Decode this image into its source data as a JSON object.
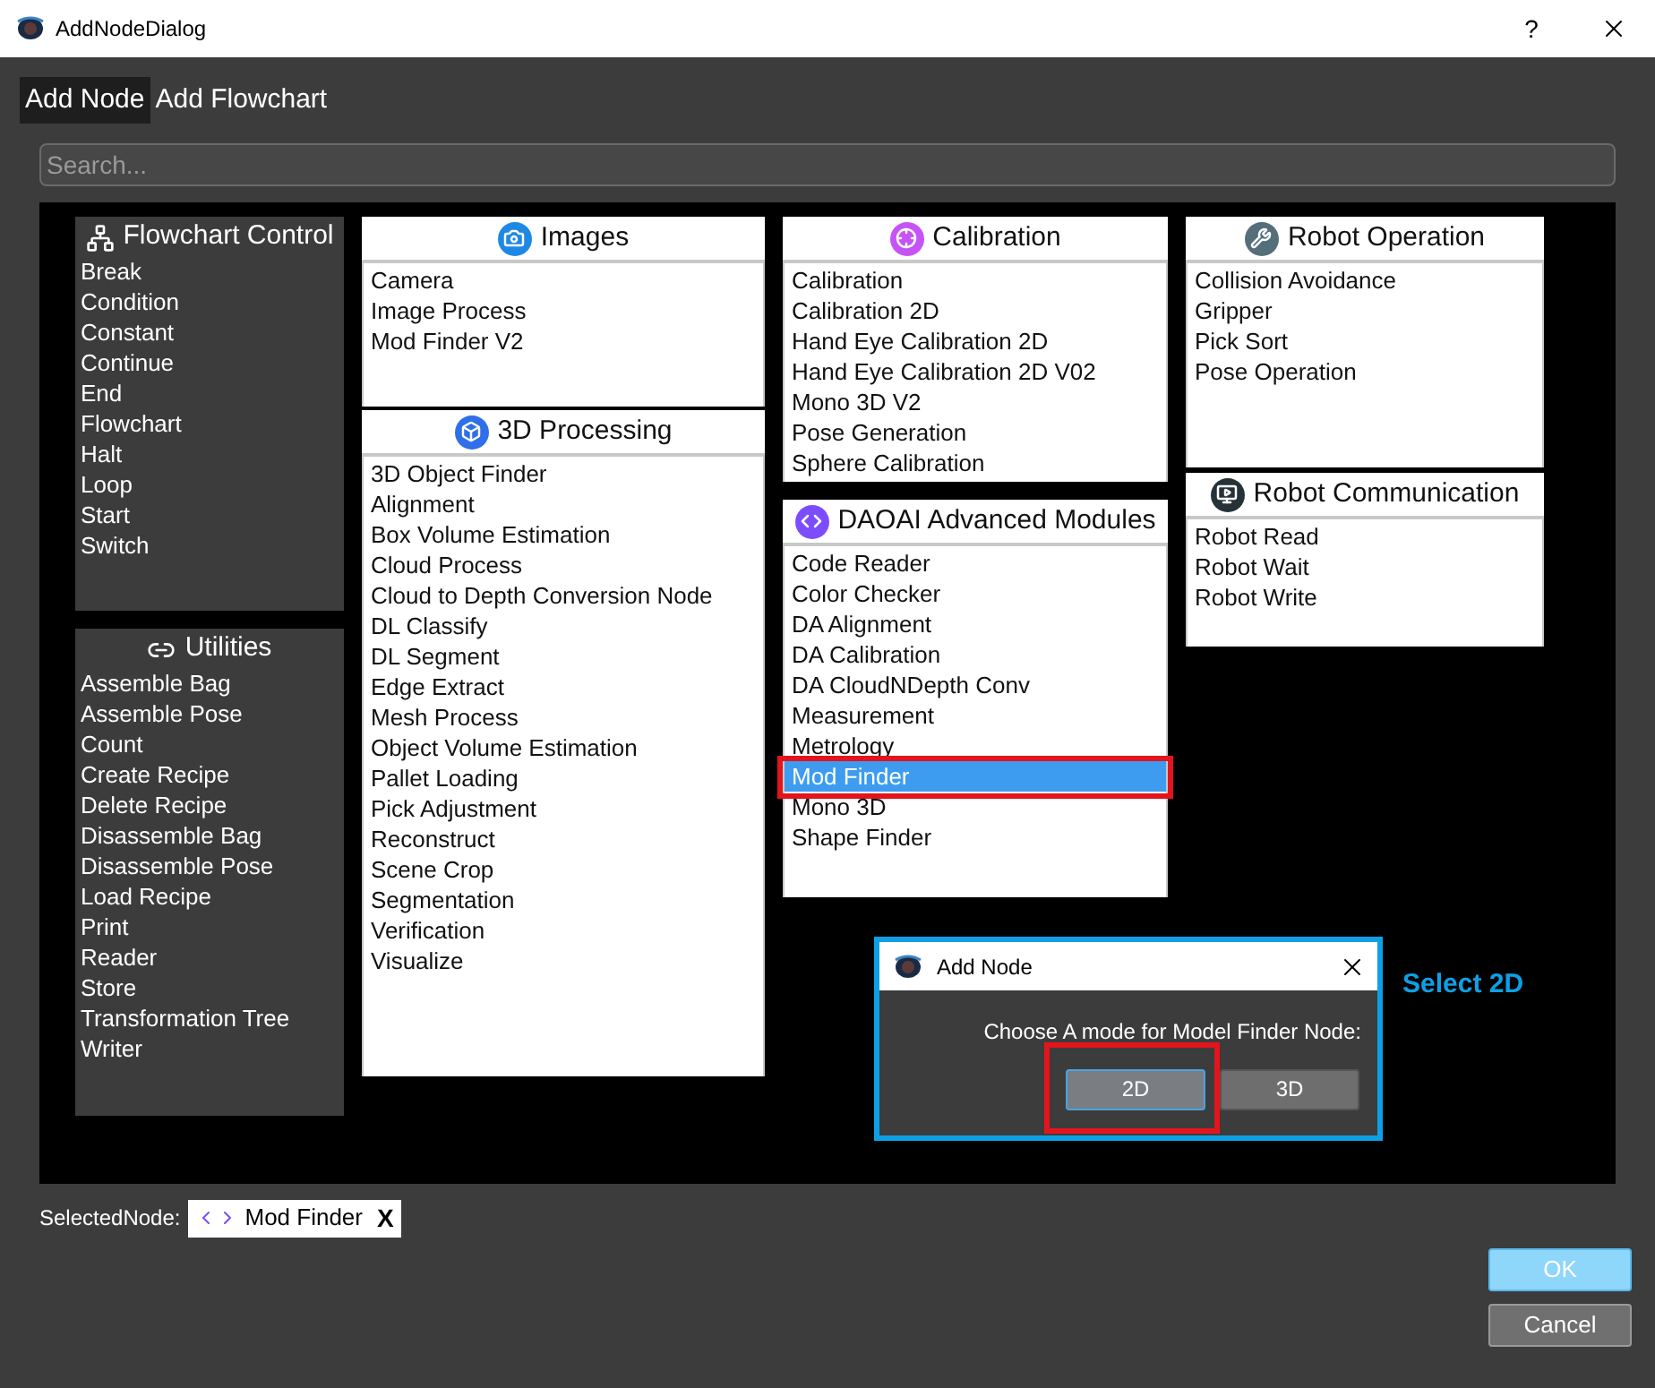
{
  "window": {
    "title": "AddNodeDialog",
    "help": "?"
  },
  "tabs": [
    {
      "label": "Add Node",
      "selected": true
    },
    {
      "label": "Add Flowchart",
      "selected": false
    }
  ],
  "search": {
    "placeholder": "Search..."
  },
  "side_groups": [
    {
      "title": "Flowchart Control",
      "kind": "tree",
      "items": [
        {
          "label": "Break",
          "selected": false
        },
        {
          "label": "Condition",
          "selected": false
        },
        {
          "label": "Constant",
          "selected": false
        },
        {
          "label": "Continue",
          "selected": false
        },
        {
          "label": "End",
          "selected": false
        },
        {
          "label": "Flowchart",
          "selected": false
        },
        {
          "label": "Halt",
          "selected": false
        },
        {
          "label": "Loop",
          "selected": false
        },
        {
          "label": "Start",
          "selected": false
        },
        {
          "label": "Switch",
          "selected": false
        }
      ]
    },
    {
      "title": "Utilities",
      "kind": "link",
      "items": [
        {
          "label": "Assemble Bag",
          "selected": false
        },
        {
          "label": "Assemble Pose",
          "selected": false
        },
        {
          "label": "Count",
          "selected": false
        },
        {
          "label": "Create Recipe",
          "selected": false
        },
        {
          "label": "Delete Recipe",
          "selected": false
        },
        {
          "label": "Disassemble Bag",
          "selected": false
        },
        {
          "label": "Disassemble Pose",
          "selected": false
        },
        {
          "label": "Load Recipe",
          "selected": false
        },
        {
          "label": "Print",
          "selected": false
        },
        {
          "label": "Reader",
          "selected": false
        },
        {
          "label": "Store",
          "selected": false
        },
        {
          "label": "Transformation Tree",
          "selected": false
        },
        {
          "label": "Writer",
          "selected": false
        }
      ]
    }
  ],
  "columns": [
    [
      {
        "title": "Images",
        "kind": "camera",
        "color": "#1e88e5",
        "items": [
          {
            "label": "Camera",
            "selected": false
          },
          {
            "label": "Image Process",
            "selected": false
          },
          {
            "label": "Mod Finder V2",
            "selected": false
          }
        ]
      },
      {
        "title": "3D Processing",
        "kind": "cube",
        "color": "#2f6fe8",
        "items": [
          {
            "label": "3D Object Finder",
            "selected": false
          },
          {
            "label": "Alignment",
            "selected": false
          },
          {
            "label": "Box Volume Estimation",
            "selected": false
          },
          {
            "label": "Cloud Process",
            "selected": false
          },
          {
            "label": "Cloud to Depth Conversion Node",
            "selected": false
          },
          {
            "label": "DL Classify",
            "selected": false
          },
          {
            "label": "DL Segment",
            "selected": false
          },
          {
            "label": "Edge Extract",
            "selected": false
          },
          {
            "label": "Mesh Process",
            "selected": false
          },
          {
            "label": "Object Volume Estimation",
            "selected": false
          },
          {
            "label": "Pallet Loading",
            "selected": false
          },
          {
            "label": "Pick Adjustment",
            "selected": false
          },
          {
            "label": "Reconstruct",
            "selected": false
          },
          {
            "label": "Scene Crop",
            "selected": false
          },
          {
            "label": "Segmentation",
            "selected": false
          },
          {
            "label": "Verification",
            "selected": false
          },
          {
            "label": "Visualize",
            "selected": false
          }
        ]
      }
    ],
    [
      {
        "title": "Calibration",
        "kind": "target",
        "color": "#c653f5",
        "items": [
          {
            "label": "Calibration",
            "selected": false
          },
          {
            "label": "Calibration 2D",
            "selected": false
          },
          {
            "label": "Hand Eye Calibration 2D",
            "selected": false
          },
          {
            "label": "Hand Eye Calibration 2D V02",
            "selected": false
          },
          {
            "label": "Mono 3D V2",
            "selected": false
          },
          {
            "label": "Pose Generation",
            "selected": false
          },
          {
            "label": "Sphere Calibration",
            "selected": false
          }
        ]
      },
      {
        "title": "DAOAI Advanced Modules",
        "kind": "code",
        "color": "#7c4dff",
        "items": [
          {
            "label": "Code Reader",
            "selected": false
          },
          {
            "label": "Color Checker",
            "selected": false
          },
          {
            "label": "DA Alignment",
            "selected": false
          },
          {
            "label": "DA Calibration",
            "selected": false
          },
          {
            "label": "DA CloudNDepth Conv",
            "selected": false
          },
          {
            "label": "Measurement",
            "selected": false
          },
          {
            "label": "Metrology",
            "selected": false
          },
          {
            "label": "Mod Finder",
            "selected": true,
            "marked": true
          },
          {
            "label": "Mono 3D",
            "selected": false
          },
          {
            "label": "Shape Finder",
            "selected": false
          }
        ]
      }
    ],
    [
      {
        "title": "Robot Operation",
        "kind": "wrench",
        "color": "#546e7a",
        "items": [
          {
            "label": "Collision Avoidance",
            "selected": false
          },
          {
            "label": "Gripper",
            "selected": false
          },
          {
            "label": "Pick Sort",
            "selected": false
          },
          {
            "label": "Pose Operation",
            "selected": false
          }
        ]
      },
      {
        "title": "Robot Communication",
        "kind": "screen",
        "color": "#263238",
        "items": [
          {
            "label": "Robot Read",
            "selected": false
          },
          {
            "label": "Robot Wait",
            "selected": false
          },
          {
            "label": "Robot Write",
            "selected": false
          }
        ]
      }
    ]
  ],
  "popup": {
    "title": "Add Node",
    "message": "Choose A mode for Model Finder Node:",
    "buttons": [
      {
        "label": "2D",
        "selected": true,
        "marked": true
      },
      {
        "label": "3D",
        "selected": false
      }
    ],
    "callout": "Select 2D"
  },
  "selected_node": {
    "label": "SelectedNode:",
    "chip": "Mod Finder",
    "remove": "X"
  },
  "buttons": [
    {
      "label": "OK",
      "kind": "primary"
    },
    {
      "label": "Cancel",
      "kind": "secondary"
    }
  ]
}
